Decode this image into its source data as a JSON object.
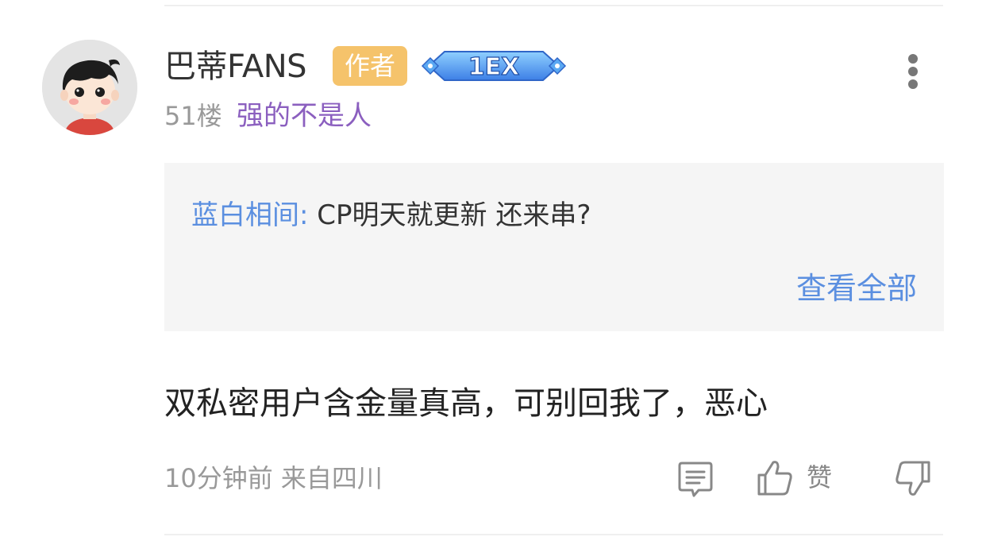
{
  "comment": {
    "username": "巴蒂FANS",
    "author_badge": "作者",
    "level_badge": "1EX",
    "floor": "51楼",
    "user_title": "强的不是人",
    "quote": {
      "author": "蓝白相间: ",
      "text": "CP明天就更新 还来串?",
      "view_all_label": "查看全部"
    },
    "content": "双私密用户含金量真高，可别回我了，恶心",
    "meta": "10分钟前 来自四川",
    "actions": {
      "like_label": "赞"
    }
  },
  "colors": {
    "author_badge": "#f5c36b",
    "title": "#8b5fbf",
    "link": "#5b8fe0",
    "quote_bg": "#f5f5f5"
  },
  "icons": [
    "more-vertical-icon",
    "reply-icon",
    "thumbs-up-icon",
    "thumbs-down-icon"
  ]
}
